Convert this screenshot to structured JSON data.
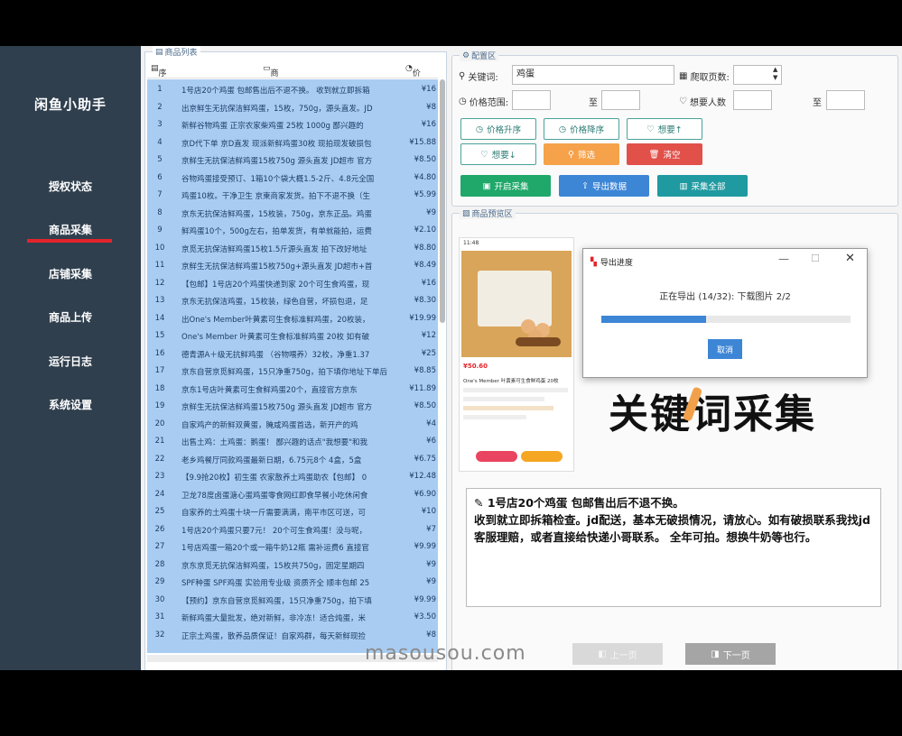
{
  "app": {
    "title": "闲鱼小助手"
  },
  "sidebar": {
    "items": [
      {
        "label": "授权状态"
      },
      {
        "label": "商品采集"
      },
      {
        "label": "店铺采集"
      },
      {
        "label": "商品上传"
      },
      {
        "label": "运行日志"
      },
      {
        "label": "系统设置"
      }
    ],
    "active_index": 1
  },
  "product_list": {
    "group_title": "商品列表",
    "columns": {
      "no": "序号",
      "name": "商品名称",
      "price": "价格"
    },
    "rows": [
      {
        "no": "1",
        "name": "1号店20个鸡蛋 包邮售出后不退不换。 收到就立即拆箱",
        "price": "¥16"
      },
      {
        "no": "2",
        "name": "出京鲜生无抗保洁鲜鸡蛋，15枚，750g，源头直发。JD",
        "price": "¥8"
      },
      {
        "no": "3",
        "name": "新鲜谷物鸡蛋  正宗农家柴鸡蛋 25枚 1000g 鄙兴趣的",
        "price": "¥16"
      },
      {
        "no": "4",
        "name": "京D代下单 京D直发 现派新鲜鸡蛋30枚 现拍现发破损包",
        "price": "¥15.88"
      },
      {
        "no": "5",
        "name": "京鲜生无抗保洁鲜鸡蛋15枚750g 源头直发 JD超市 官方",
        "price": "¥8.50"
      },
      {
        "no": "6",
        "name": "谷物鸡蛋接受预订、1箱10个袋大概1.5-2斤、4.8元全国",
        "price": "¥4.80"
      },
      {
        "no": "7",
        "name": "鸡蛋10枚。干净卫生 京東商家发货。拍下不退不换（生",
        "price": "¥5.99"
      },
      {
        "no": "8",
        "name": "京东无抗保洁鲜鸡蛋，15枚装，750g，京东正品。鸡蛋",
        "price": "¥9"
      },
      {
        "no": "9",
        "name": "鲜鸡蛋10个，500g左右，拍单发货，有单就能拍，运费",
        "price": "¥2.10"
      },
      {
        "no": "10",
        "name": "京觅无抗保洁鲜鸡蛋15枚1.5斤源头直发 拍下改好地址",
        "price": "¥8.80"
      },
      {
        "no": "11",
        "name": "京鲜生无抗保洁鲜鸡蛋15枚750g+源头直发 JD超市+首",
        "price": "¥8.49"
      },
      {
        "no": "12",
        "name": "【包邮】1号店20个鸡蛋快递到家 20个可生食鸡蛋，现",
        "price": "¥16"
      },
      {
        "no": "13",
        "name": "京东无抗保洁鸡蛋，15枚装，绿色自营，坏损包退，足",
        "price": "¥8.30"
      },
      {
        "no": "14",
        "name": "出One's Member叶黄素可生食标准鲜鸡蛋，20枚装，",
        "price": "¥19.99"
      },
      {
        "no": "15",
        "name": "One's Member 叶黄素可生食标准鲜鸡蛋 20枚 如有破",
        "price": "¥12"
      },
      {
        "no": "16",
        "name": "德青源A＋级无抗鲜鸡蛋 （谷物喂养）32枚，净重1.37",
        "price": "¥25"
      },
      {
        "no": "17",
        "name": "京东自营京觅鲜鸡蛋，15只净重750g，拍下填你地址下单后",
        "price": "¥8.85"
      },
      {
        "no": "18",
        "name": "京东1号店叶黄素可生食鲜鸡蛋20个，直接官方京东",
        "price": "¥11.89"
      },
      {
        "no": "19",
        "name": "京鲜生无抗保洁鲜鸡蛋15枚750g 源头直发 JD超市 官方",
        "price": "¥8.50"
      },
      {
        "no": "20",
        "name": "自家鸡产的新鲜双黄蛋，腌咸鸡蛋首选，新开产的鸡",
        "price": "¥4"
      },
      {
        "no": "21",
        "name": "出售土鸡：土鸡蛋：鹅蛋！ 鄙兴趣的话点\"我想要\"和我",
        "price": "¥6"
      },
      {
        "no": "22",
        "name": "老乡鸡餐厅同款鸡蛋最新日期，6.75元8个 4盒，5盒",
        "price": "¥6.75"
      },
      {
        "no": "23",
        "name": "【9.9抢20枚】初生蛋 农家散养土鸡蛋助农【包邮】 0",
        "price": "¥12.48"
      },
      {
        "no": "24",
        "name": "卫龙78度卤蛋溏心蛋鸡蛋零食网红即食早餐小吃休闲食",
        "price": "¥6.90"
      },
      {
        "no": "25",
        "name": "自家养的土鸡蛋十块一斤需要满满，南平市区可送，可",
        "price": "¥10"
      },
      {
        "no": "26",
        "name": "1号店20个鸡蛋只要7元！ 20个可生食鸡蛋！没与呢，",
        "price": "¥7"
      },
      {
        "no": "27",
        "name": "1号店鸡蛋一箱20个或一箱牛奶12瓶 需补运费6 直接官",
        "price": "¥9.99"
      },
      {
        "no": "28",
        "name": "京东京觅无抗保洁鲜鸡蛋，15枚共750g，固定星期四",
        "price": "¥9"
      },
      {
        "no": "29",
        "name": "SPF种蛋 SPF鸡蛋 实验用专业级 资质齐全 顺丰包邮 25",
        "price": "¥9"
      },
      {
        "no": "30",
        "name": "【预约】京东自营京觅鲜鸡蛋，15只净重750g，拍下填",
        "price": "¥9.99"
      },
      {
        "no": "31",
        "name": "新鲜鸡蛋大量批发，绝对新鲜，非冷冻！适合炖蛋，米",
        "price": "¥3.50"
      },
      {
        "no": "32",
        "name": "正宗土鸡蛋，散养品质保证！自家鸡群，每天新鲜现捡",
        "price": "¥8"
      }
    ]
  },
  "config": {
    "group_title": "配置区",
    "keyword_label": "关键词:",
    "keyword_value": "鸡蛋",
    "pages_label": "爬取页数:",
    "pages_value": "",
    "price_range_label": "价格范围:",
    "price_to_label": "至",
    "wants_label": "想要人数",
    "wants_to_label": "至",
    "buttons": {
      "price_asc": "价格升序",
      "price_desc": "价格降序",
      "wants1": "想要↑",
      "wants2": "想要↓",
      "filter": "筛选",
      "clear": "清空",
      "start": "开启采集",
      "export": "导出数据",
      "collect_all": "采集全部"
    }
  },
  "preview": {
    "group_title": "商品预览区",
    "overlay_text": "关键词采集",
    "description_line1": "1号店20个鸡蛋 包邮售出后不退不换。",
    "description_line2": "收到就立即拆箱检查。jd配送，基本无破损情况，请放心。如有破损联系我找jd客服理赔，或者直接给快递小哥联系。  全年可拍。想换牛奶等也行。",
    "phone": {
      "time": "11:48",
      "price": "¥50.60",
      "product_title": "One's Member 叶黄素可生食鲜鸡蛋 20枚"
    },
    "prev_label": "上一页",
    "next_label": "下一页"
  },
  "export_dialog": {
    "title": "导出进度",
    "status": "正在导出 (14/32): 下载图片 2/2",
    "progress": 0.42,
    "cancel_label": "取消"
  },
  "watermark": "masousou.com",
  "colors": {
    "sidebar_bg": "#2f3f4e",
    "active_underline": "#e3242b",
    "table_selection": "#a9cdf2",
    "accent_blue": "#3d86d6"
  }
}
